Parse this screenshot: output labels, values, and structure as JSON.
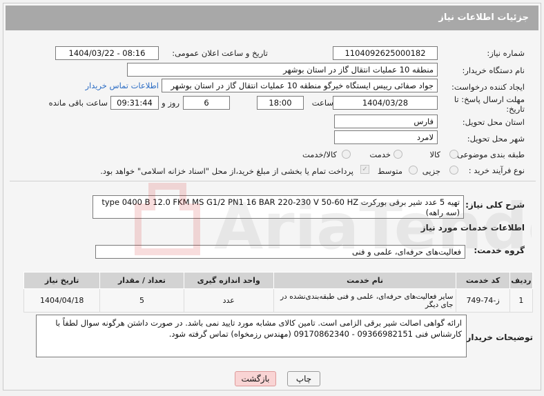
{
  "header": {
    "title": "جزئیات اطلاعات نیاز"
  },
  "fields": {
    "need_number_label": "شماره نیاز:",
    "need_number": "1104092625000182",
    "announce_label": "تاریخ و ساعت اعلان عمومی:",
    "announce_value": "1404/03/22 - 08:16",
    "buyer_org_label": "نام دستگاه خریدار:",
    "buyer_org": "منطقه 10 عملیات انتقال گاز در استان بوشهر",
    "creator_label": "ایجاد کننده درخواست:",
    "creator": "جواد صفائی رییس ایستگاه خیرگو منطقه 10 عملیات انتقال گاز در استان بوشهر",
    "buyer_contact_link": "اطلاعات تماس خریدار",
    "deadline_label": "مهلت ارسال پاسخ: تا تاریخ:",
    "deadline_date": "1404/03/28",
    "time_label": "ساعت",
    "deadline_time": "18:00",
    "days_value": "6",
    "days_label": "روز و",
    "remaining_time": "09:31:44",
    "remaining_label": "ساعت باقی مانده",
    "province_label": "استان محل تحویل:",
    "province": "فارس",
    "city_label": "شهر محل تحویل:",
    "city": "لامرد",
    "category_label": "طبقه بندی موضوعی:",
    "category_options": [
      "کالا",
      "خدمت",
      "کالا/خدمت"
    ],
    "category_selected": "خدمت",
    "process_label": "نوع فرآیند خرید :",
    "process_options": [
      "جزیی",
      "متوسط"
    ],
    "treasury_note": "پرداخت تمام یا بخشی از مبلغ خرید،از محل \"اسناد خزانه اسلامی\" خواهد بود."
  },
  "summary": {
    "label": "شرح کلی نیاز:",
    "text": "تهیه 5 عدد شیر برقی بورکرت type 0400 B 12.0 FKM MS G1/2 PN1 16 BAR 220-230 V 50-60 HZ (سه راهه)"
  },
  "services": {
    "section_title": "اطلاعات خدمات مورد نیاز",
    "group_label": "گروه خدمت:",
    "group_value": "فعالیت‌های حرفه‌ای، علمی و فنی",
    "columns": [
      "ردیف",
      "کد خدمت",
      "نام خدمت",
      "واحد اندازه گیری",
      "تعداد / مقدار",
      "تاریخ نیاز"
    ],
    "rows": [
      [
        "1",
        "ز-74-749",
        "سایر فعالیت‌های حرفه‌ای، علمی و فنی طبقه‌بندی‌نشده در جای دیگر",
        "عدد",
        "5",
        "1404/04/18"
      ]
    ]
  },
  "buyer_notes": {
    "label": "توضیحات خریدار:",
    "text": "ارائه گواهی اصالت شیر برقی الزامی است. تامین کالای مشابه مورد تایید نمی باشد. در صورت داشتن هرگونه سوال لطفاً با کارشناس فنی 09366982151 - 09170862340 (مهندس رزمخواه) تماس گرفته شود."
  },
  "buttons": {
    "print": "چاپ",
    "back": "بازگشت"
  },
  "watermark": "AriaTender.net"
}
